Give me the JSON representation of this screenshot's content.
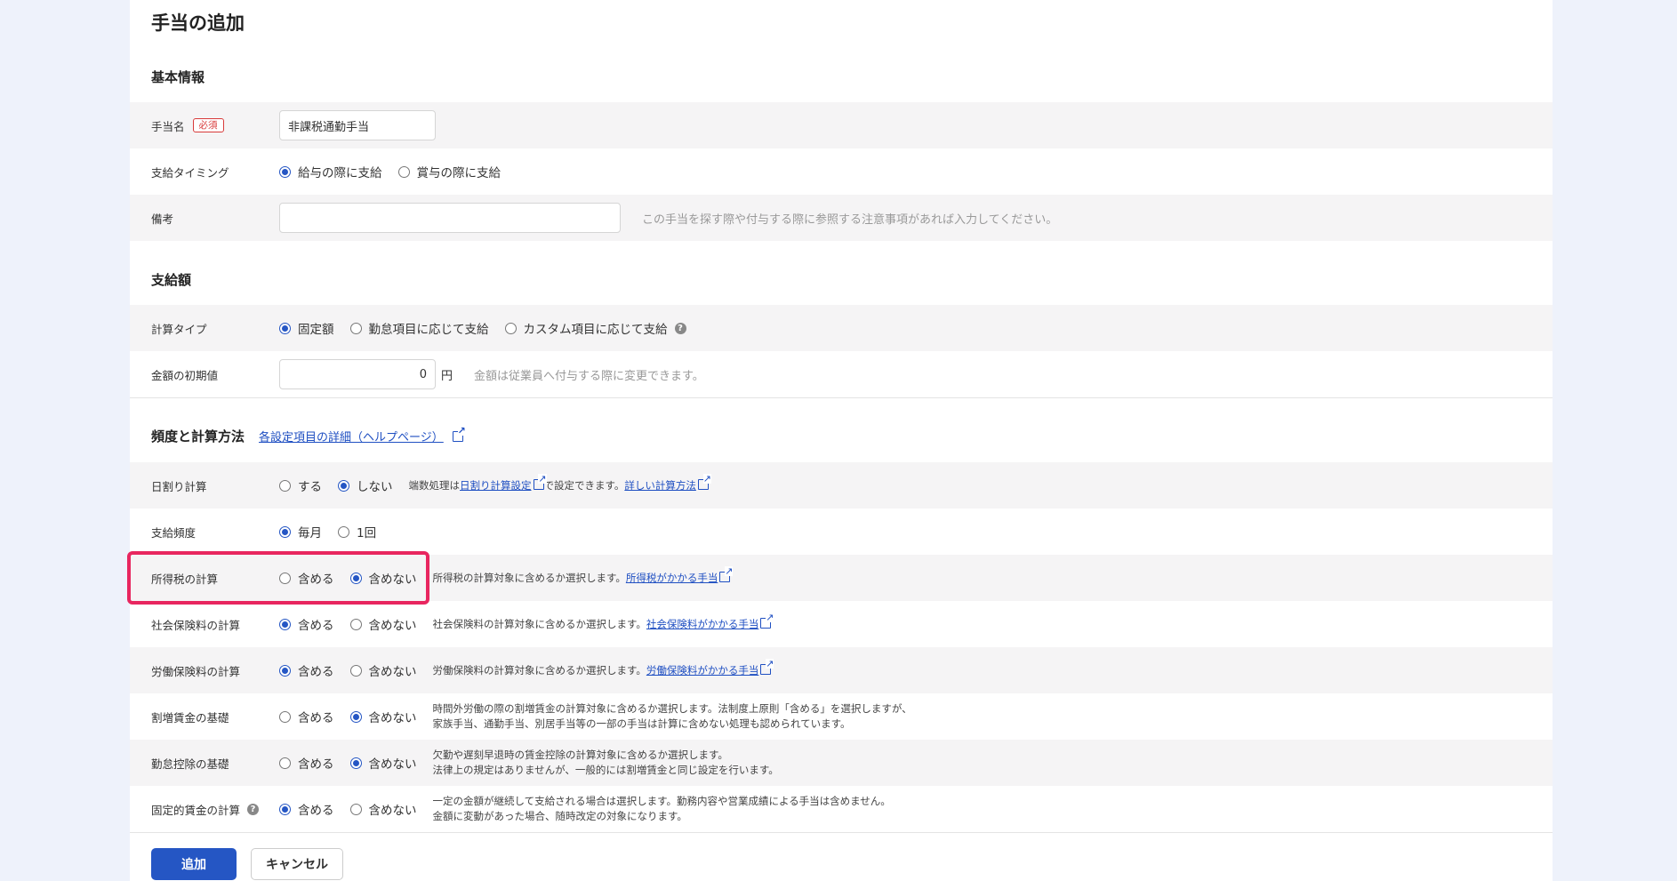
{
  "title": "手当の追加",
  "basic": {
    "section": "基本情報",
    "name_label": "手当名",
    "required": "必須",
    "name_value": "非課税通勤手当",
    "timing_label": "支給タイミング",
    "timing_options": [
      "給与の際に支給",
      "賞与の際に支給"
    ],
    "remarks_label": "備考",
    "remarks_hint": "この手当を探す際や付与する際に参照する注意事項があれば入力してください。"
  },
  "amount": {
    "section": "支給額",
    "calc_label": "計算タイプ",
    "calc_options": [
      "固定額",
      "勤怠項目に応じて支給",
      "カスタム項目に応じて支給"
    ],
    "initial_label": "金額の初期値",
    "initial_value": "0",
    "unit": "円",
    "initial_hint": "金額は従業員へ付与する際に変更できます。"
  },
  "freq": {
    "section": "頻度と計算方法",
    "help_link": "各設定項目の詳細（ヘルプページ）",
    "daily_label": "日割り計算",
    "daily_options": [
      "する",
      "しない"
    ],
    "daily_note_prefix": "端数処理は",
    "daily_note_link1": "日割り計算設定",
    "daily_note_mid": "で設定できます。",
    "daily_note_link2": "詳しい計算方法",
    "payfreq_label": "支給頻度",
    "payfreq_options": [
      "毎月",
      "1回"
    ],
    "include": "含める",
    "exclude": "含めない",
    "income_tax_label": "所得税の計算",
    "income_tax_note": "所得税の計算対象に含めるか選択します。",
    "income_tax_link": "所得税がかかる手当",
    "social_label": "社会保険料の計算",
    "social_note": "社会保険料の計算対象に含めるか選択します。",
    "social_link": "社会保険料がかかる手当",
    "labor_label": "労働保険料の計算",
    "labor_note": "労働保険料の計算対象に含めるか選択します。",
    "labor_link": "労働保険料がかかる手当",
    "premium_label": "割増賃金の基礎",
    "premium_note1": "時間外労働の際の割増賃金の計算対象に含めるか選択します。法制度上原則「含める」を選択しますが、",
    "premium_note2": "家族手当、通勤手当、別居手当等の一部の手当は計算に含めない処理も認められています。",
    "deduct_label": "勤怠控除の基礎",
    "deduct_note1": "欠勤や遅刻早退時の賃金控除の計算対象に含めるか選択します。",
    "deduct_note2": "法律上の規定はありませんが、一般的には割増賃金と同じ設定を行います。",
    "fixed_label": "固定的賃金の計算",
    "fixed_note1": "一定の金額が継続して支給される場合は選択します。勤務内容や営業成績による手当は含めません。",
    "fixed_note2": "金額に変動があった場合、随時改定の対象になります。"
  },
  "buttons": {
    "add": "追加",
    "cancel": "キャンセル"
  }
}
